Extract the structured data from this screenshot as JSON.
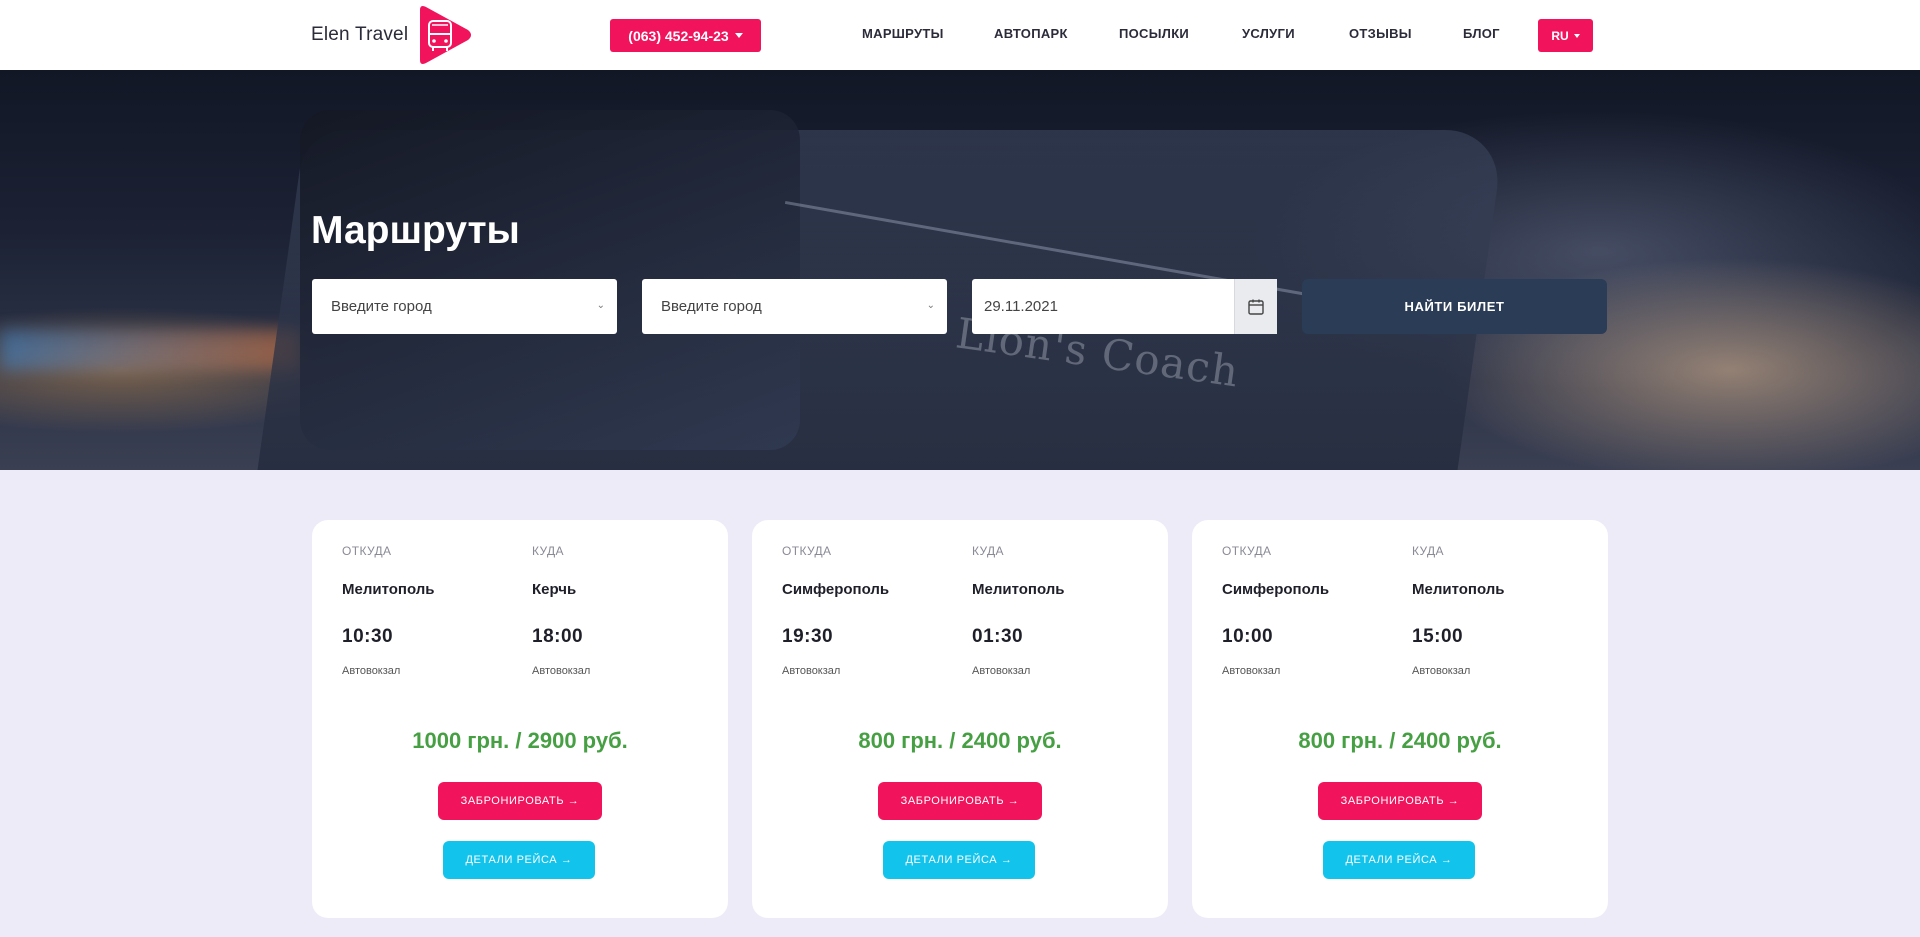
{
  "header": {
    "logo_text": "Elen Travel",
    "phone": "(063) 452-94-23",
    "nav": [
      {
        "label": "МАРШРУТЫ"
      },
      {
        "label": "АВТОПАРК"
      },
      {
        "label": "ПОСЫЛКИ"
      },
      {
        "label": "УСЛУГИ"
      },
      {
        "label": "ОТЗЫВЫ"
      },
      {
        "label": "БЛОГ"
      }
    ],
    "lang": "RU"
  },
  "hero": {
    "title": "Маршруты",
    "from_placeholder": "Введите город",
    "to_placeholder": "Введите город",
    "date": "29.11.2021",
    "search_label": "НАЙТИ БИЛЕТ"
  },
  "cards": [
    {
      "from_label": "ОТКУДА",
      "to_label": "КУДА",
      "from_city": "Мелитополь",
      "to_city": "Керчь",
      "depart": "10:30",
      "arrive": "18:00",
      "from_station": "Автовокзал",
      "to_station": "Автовокзал",
      "price": "1000 грн. / 2900 руб.",
      "book_label": "ЗАБРОНИРОВАТЬ →",
      "details_label": "ДЕТАЛИ РЕЙСА →"
    },
    {
      "from_label": "ОТКУДА",
      "to_label": "КУДА",
      "from_city": "Симферополь",
      "to_city": "Мелитополь",
      "depart": "19:30",
      "arrive": "01:30",
      "from_station": "Автовокзал",
      "to_station": "Автовокзал",
      "price": "800 грн. / 2400 руб.",
      "book_label": "ЗАБРОНИРОВАТЬ →",
      "details_label": "ДЕТАЛИ РЕЙСА →"
    },
    {
      "from_label": "ОТКУДА",
      "to_label": "КУДА",
      "from_city": "Симферополь",
      "to_city": "Мелитополь",
      "depart": "10:00",
      "arrive": "15:00",
      "from_station": "Автовокзал",
      "to_station": "Автовокзал",
      "price": "800 грн. / 2400 руб.",
      "book_label": "ЗАБРОНИРОВАТЬ →",
      "details_label": "ДЕТАЛИ РЕЙСА →"
    }
  ],
  "colors": {
    "accent": "#f2135d",
    "navy": "#2a3c56",
    "price_green": "#46a043",
    "details_blue": "#12c3ec",
    "page_bg": "#ecebf7"
  },
  "icons": [
    "bus-logo-icon",
    "calendar-icon",
    "chevron-down-icon"
  ]
}
